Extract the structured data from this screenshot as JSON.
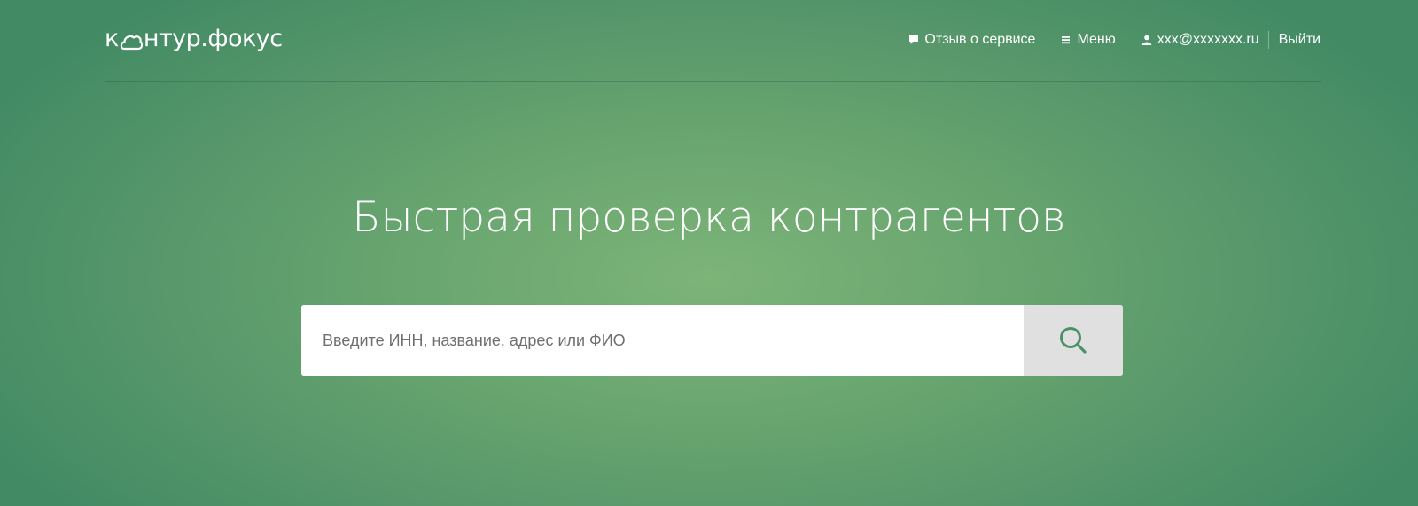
{
  "header": {
    "logo": {
      "prefix": "к",
      "suffix": "нтур.фокус",
      "icon": "cloud-icon"
    },
    "nav": {
      "feedback": {
        "label": "Отзыв о сервисе",
        "icon": "speech-bubble-icon"
      },
      "menu": {
        "label": "Меню",
        "icon": "hamburger-icon"
      },
      "user": {
        "label": "xxx@xxxxxxx.ru",
        "icon": "user-icon"
      },
      "logout": {
        "label": "Выйти"
      }
    }
  },
  "main": {
    "headline": "Быстрая проверка контрагентов",
    "search": {
      "placeholder": "Введите ИНН, название, адрес или ФИО",
      "value": "",
      "button_icon": "search-icon"
    }
  },
  "colors": {
    "background_center": "#7db478",
    "background_edge": "#418a64",
    "search_button_bg": "#e0e0e0",
    "search_icon": "#4a9168",
    "text": "#ffffff"
  }
}
